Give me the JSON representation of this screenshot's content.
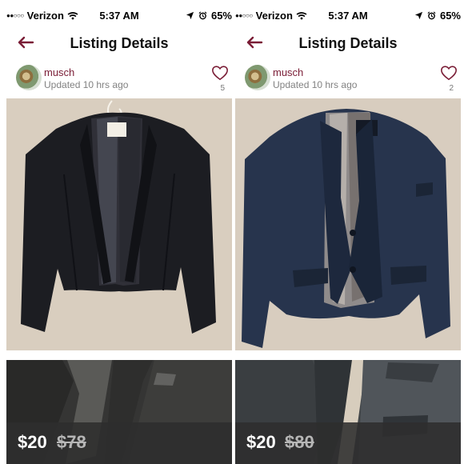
{
  "panels": [
    {
      "status": {
        "carrier": "Verizon",
        "time": "5:37 AM",
        "battery": "65%"
      },
      "nav": {
        "title": "Listing Details"
      },
      "seller": {
        "name": "musch",
        "updated": "Updated 10 hrs ago",
        "likes": "5"
      },
      "price": {
        "current": "$20",
        "original": "$78"
      },
      "icons": {
        "back": "back-arrow-icon",
        "heart": "heart-outline-icon",
        "wifi": "wifi-icon",
        "location": "location-arrow-icon",
        "alarm": "alarm-clock-icon"
      },
      "colors": {
        "accent": "#7a1d36",
        "price_bar": "#2d2d2d"
      }
    },
    {
      "status": {
        "carrier": "Verizon",
        "time": "5:37 AM",
        "battery": "65%"
      },
      "nav": {
        "title": "Listing Details"
      },
      "seller": {
        "name": "musch",
        "updated": "Updated 10 hrs ago",
        "likes": "2"
      },
      "price": {
        "current": "$20",
        "original": "$80"
      },
      "icons": {
        "back": "back-arrow-icon",
        "heart": "heart-outline-icon",
        "wifi": "wifi-icon",
        "location": "location-arrow-icon",
        "alarm": "alarm-clock-icon"
      },
      "colors": {
        "accent": "#7a1d36",
        "price_bar": "#2d2d2d"
      }
    }
  ]
}
